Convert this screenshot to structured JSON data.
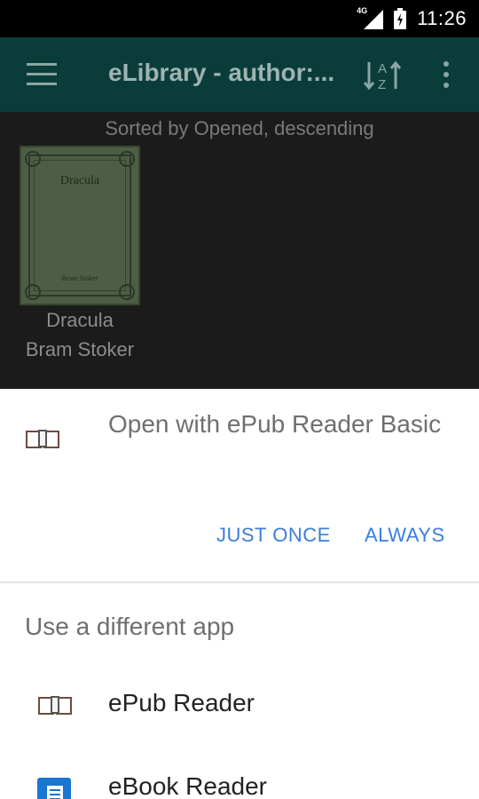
{
  "status_bar": {
    "network_label": "4G",
    "time": "11:26",
    "icons": [
      "signal-icon",
      "battery-icon"
    ]
  },
  "app_bar": {
    "title": "eLibrary - author:...",
    "icons": [
      "menu-icon",
      "sort-az-icon",
      "more-vert-icon"
    ]
  },
  "library": {
    "sort_label": "Sorted by Opened, descending",
    "books": [
      {
        "cover_title": "Dracula",
        "cover_author": "Bram Stoker",
        "title": "Dracula",
        "author": "Bram Stoker"
      }
    ]
  },
  "chooser": {
    "default_app_label": "Open with ePub Reader Basic",
    "just_once_label": "JUST ONCE",
    "always_label": "ALWAYS",
    "different_app_label": "Use a different app",
    "apps": [
      {
        "name": "ePub Reader",
        "icon": "open-book-icon"
      },
      {
        "name": "eBook Reader",
        "icon": "ebook-reader-icon"
      }
    ]
  },
  "colors": {
    "app_bar": "#0a3d3a",
    "accent": "#3b7de0",
    "content_bg": "#1b1b1b",
    "sheet_bg": "#ffffff"
  }
}
